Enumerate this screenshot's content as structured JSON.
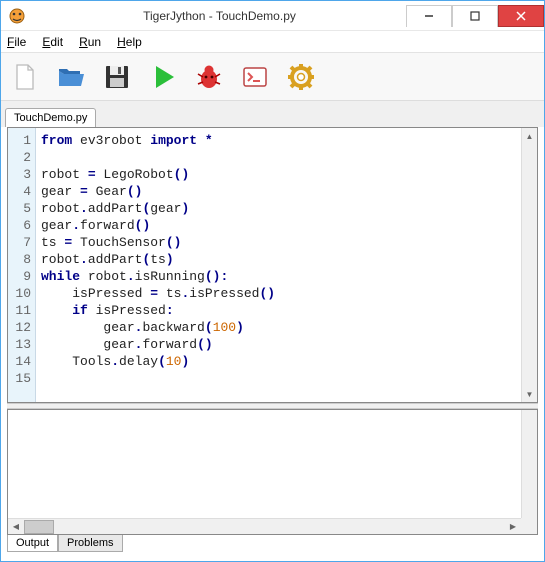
{
  "window": {
    "title": "TigerJython - TouchDemo.py"
  },
  "menu": {
    "file": "File",
    "edit": "Edit",
    "run": "Run",
    "help": "Help"
  },
  "toolbar": {
    "new": "new-file",
    "open": "open-file",
    "save": "save-file",
    "run": "run-script",
    "debug": "debug",
    "terminal": "terminal",
    "settings": "settings"
  },
  "file_tab": {
    "label": "TouchDemo.py"
  },
  "code": {
    "lines": [
      {
        "n": 1,
        "tokens": [
          [
            "kw",
            "from"
          ],
          [
            "sp",
            " "
          ],
          [
            "nm",
            "ev3robot"
          ],
          [
            "sp",
            " "
          ],
          [
            "kw",
            "import"
          ],
          [
            "sp",
            " "
          ],
          [
            "op",
            "*"
          ]
        ]
      },
      {
        "n": 2,
        "tokens": []
      },
      {
        "n": 3,
        "tokens": [
          [
            "nm",
            "robot "
          ],
          [
            "op",
            "="
          ],
          [
            "nm",
            " LegoRobot"
          ],
          [
            "op",
            "()"
          ]
        ]
      },
      {
        "n": 4,
        "tokens": [
          [
            "nm",
            "gear "
          ],
          [
            "op",
            "="
          ],
          [
            "nm",
            " Gear"
          ],
          [
            "op",
            "()"
          ]
        ]
      },
      {
        "n": 5,
        "tokens": [
          [
            "nm",
            "robot"
          ],
          [
            "op",
            "."
          ],
          [
            "nm",
            "addPart"
          ],
          [
            "op",
            "("
          ],
          [
            "nm",
            "gear"
          ],
          [
            "op",
            ")"
          ]
        ]
      },
      {
        "n": 6,
        "tokens": [
          [
            "nm",
            "gear"
          ],
          [
            "op",
            "."
          ],
          [
            "nm",
            "forward"
          ],
          [
            "op",
            "()"
          ]
        ]
      },
      {
        "n": 7,
        "tokens": [
          [
            "nm",
            "ts "
          ],
          [
            "op",
            "="
          ],
          [
            "nm",
            " TouchSensor"
          ],
          [
            "op",
            "()"
          ]
        ]
      },
      {
        "n": 8,
        "tokens": [
          [
            "nm",
            "robot"
          ],
          [
            "op",
            "."
          ],
          [
            "nm",
            "addPart"
          ],
          [
            "op",
            "("
          ],
          [
            "nm",
            "ts"
          ],
          [
            "op",
            ")"
          ]
        ]
      },
      {
        "n": 9,
        "tokens": [
          [
            "kw",
            "while"
          ],
          [
            "nm",
            " robot"
          ],
          [
            "op",
            "."
          ],
          [
            "nm",
            "isRunning"
          ],
          [
            "op",
            "():"
          ]
        ]
      },
      {
        "n": 10,
        "tokens": [
          [
            "sp",
            "    "
          ],
          [
            "nm",
            "isPressed "
          ],
          [
            "op",
            "="
          ],
          [
            "nm",
            " ts"
          ],
          [
            "op",
            "."
          ],
          [
            "nm",
            "isPressed"
          ],
          [
            "op",
            "()"
          ]
        ]
      },
      {
        "n": 11,
        "tokens": [
          [
            "sp",
            "    "
          ],
          [
            "kw",
            "if"
          ],
          [
            "nm",
            " isPressed"
          ],
          [
            "op",
            ":"
          ]
        ]
      },
      {
        "n": 12,
        "tokens": [
          [
            "sp",
            "        "
          ],
          [
            "nm",
            "gear"
          ],
          [
            "op",
            "."
          ],
          [
            "nm",
            "backward"
          ],
          [
            "op",
            "("
          ],
          [
            "num",
            "100"
          ],
          [
            "op",
            ")"
          ]
        ]
      },
      {
        "n": 13,
        "tokens": [
          [
            "sp",
            "        "
          ],
          [
            "nm",
            "gear"
          ],
          [
            "op",
            "."
          ],
          [
            "nm",
            "forward"
          ],
          [
            "op",
            "()"
          ]
        ]
      },
      {
        "n": 14,
        "tokens": [
          [
            "sp",
            "    "
          ],
          [
            "nm",
            "Tools"
          ],
          [
            "op",
            "."
          ],
          [
            "nm",
            "delay"
          ],
          [
            "op",
            "("
          ],
          [
            "num",
            "10"
          ],
          [
            "op",
            ")"
          ]
        ]
      },
      {
        "n": 15,
        "tokens": []
      }
    ]
  },
  "bottom_tabs": {
    "output": "Output",
    "problems": "Problems"
  }
}
